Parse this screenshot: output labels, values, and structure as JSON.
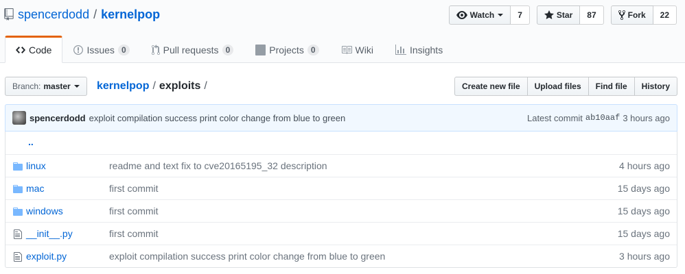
{
  "repo": {
    "owner": "spencerdodd",
    "separator": "/",
    "name": "kernelpop"
  },
  "actions": {
    "watch": {
      "label": "Watch",
      "count": "7"
    },
    "star": {
      "label": "Star",
      "count": "87"
    },
    "fork": {
      "label": "Fork",
      "count": "22"
    }
  },
  "nav": [
    {
      "label": "Code",
      "icon": "code-icon",
      "selected": true
    },
    {
      "label": "Issues",
      "count": "0",
      "icon": "issue-icon"
    },
    {
      "label": "Pull requests",
      "count": "0",
      "icon": "pull-request-icon"
    },
    {
      "label": "Projects",
      "count": "0",
      "icon": "project-icon"
    },
    {
      "label": "Wiki",
      "icon": "book-icon"
    },
    {
      "label": "Insights",
      "icon": "graph-icon"
    }
  ],
  "branch": {
    "prefix": "Branch:",
    "name": "master"
  },
  "breadcrumb": {
    "repo": "kernelpop",
    "sep1": "/",
    "dir": "exploits",
    "sep2": "/"
  },
  "file_actions": [
    "Create new file",
    "Upload files",
    "Find file",
    "History"
  ],
  "commit": {
    "author": "spencerdodd",
    "message": "exploit compilation success print color change from blue to green",
    "latest_label": "Latest commit",
    "sha": "ab10aaf",
    "age": "3 hours ago"
  },
  "parent_dir": "..",
  "files": [
    {
      "type": "dir",
      "icon": "folder-icon",
      "name": "linux",
      "message": "readme and text fix to cve20165195_32 description",
      "age": "4 hours ago"
    },
    {
      "type": "dir",
      "icon": "folder-icon",
      "name": "mac",
      "message": "first commit",
      "age": "15 days ago"
    },
    {
      "type": "dir",
      "icon": "folder-icon",
      "name": "windows",
      "message": "first commit",
      "age": "15 days ago"
    },
    {
      "type": "file",
      "icon": "file-icon",
      "name": "__init__.py",
      "message": "first commit",
      "age": "15 days ago"
    },
    {
      "type": "file",
      "icon": "file-icon",
      "name": "exploit.py",
      "message": "exploit compilation success print color change from blue to green",
      "age": "3 hours ago"
    }
  ],
  "colors": {
    "link": "#0366d6",
    "accent_tab": "#e36209",
    "commit_bg": "#f1f8ff",
    "folder": "#79b8ff"
  }
}
